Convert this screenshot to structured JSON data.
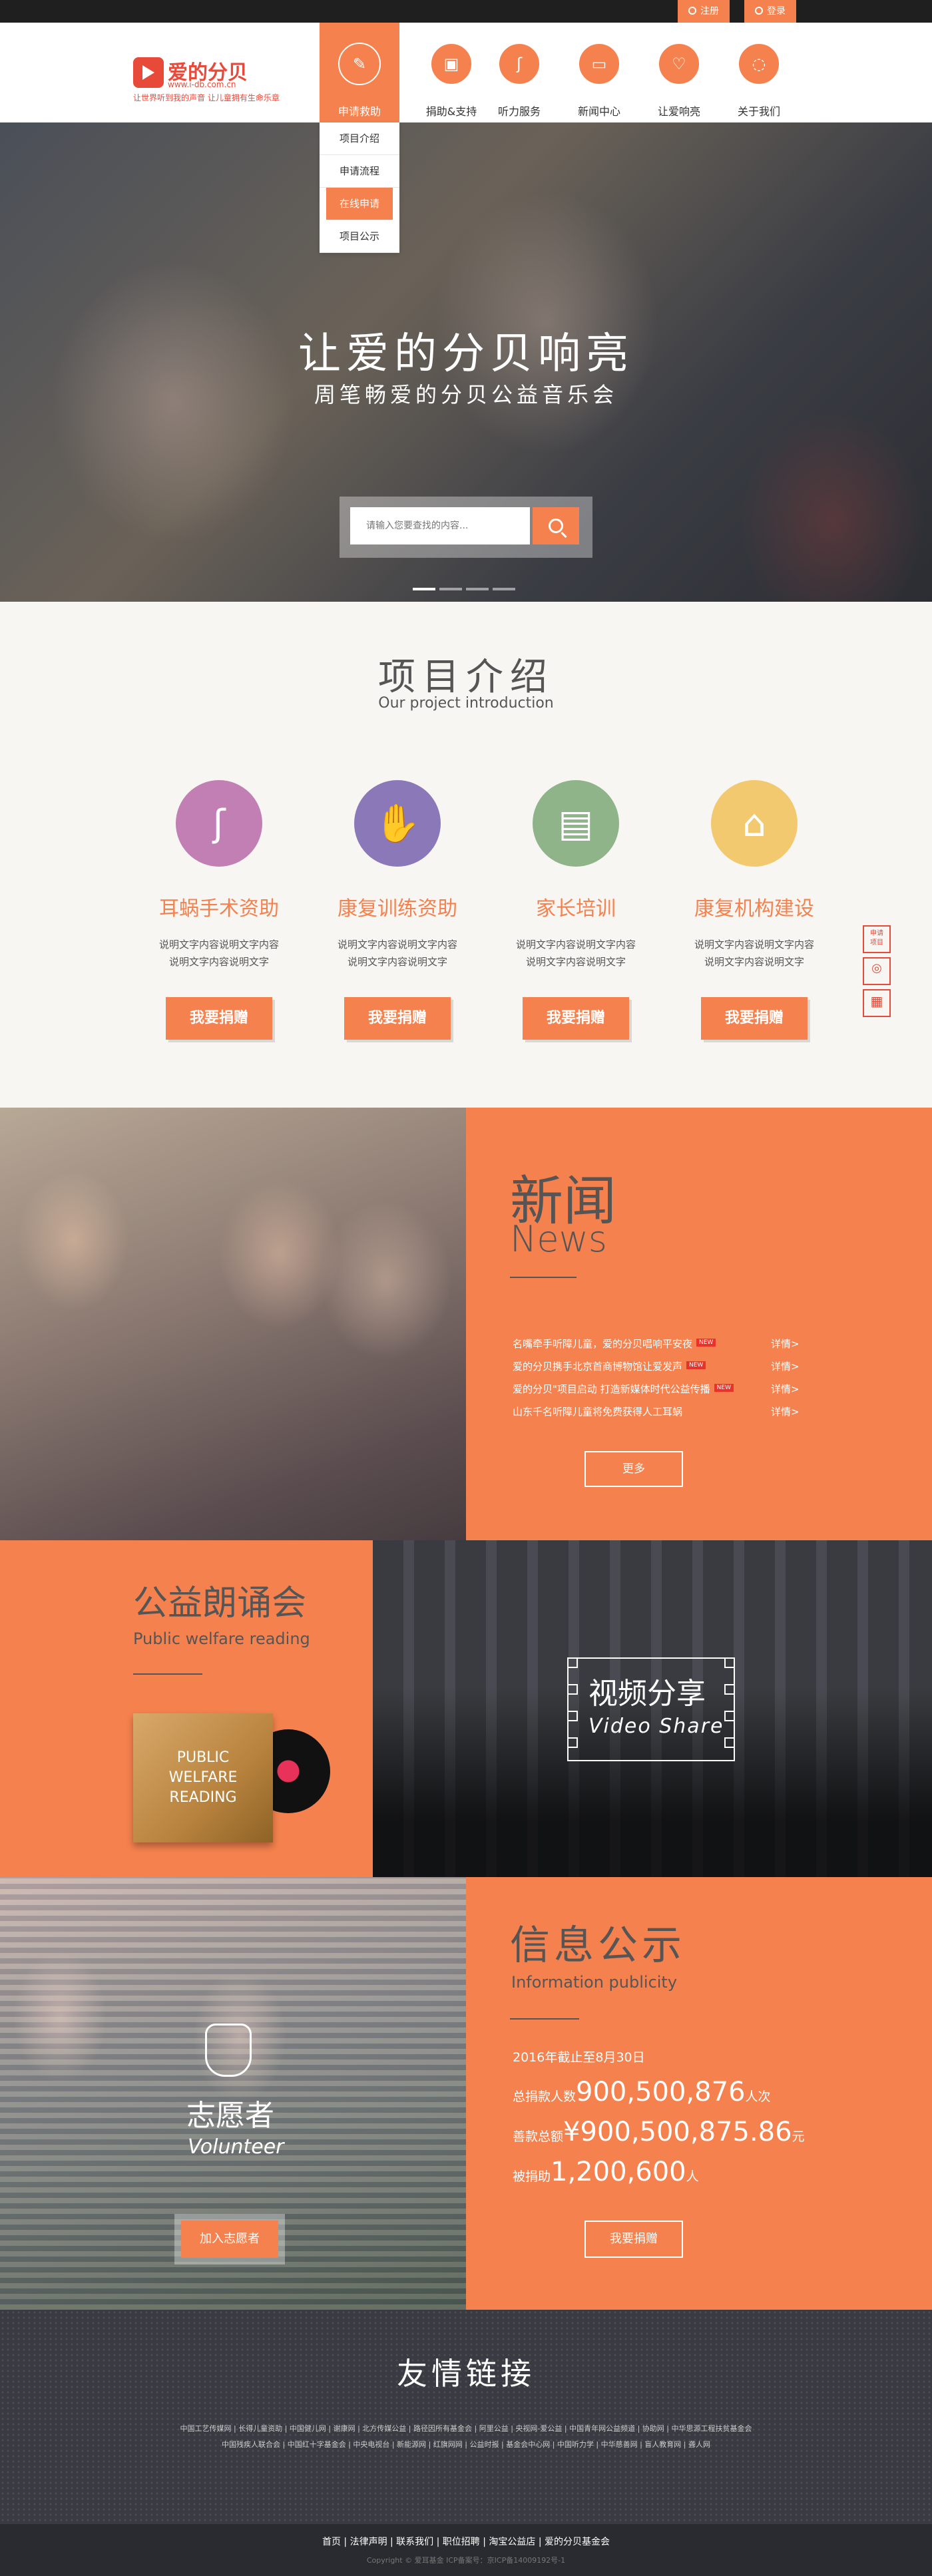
{
  "topbar": {
    "register": "注册",
    "login": "登录"
  },
  "logo": {
    "name": "爱的分贝",
    "url": "www.i-db.com.cn",
    "slogan": "让世界听到我的声音 让儿童拥有生命乐章"
  },
  "nav": [
    {
      "label": "申请救助",
      "icon": "pencil-icon"
    },
    {
      "label": "捐助&支持",
      "icon": "gift-icon"
    },
    {
      "label": "听力服务",
      "icon": "ear-icon"
    },
    {
      "label": "新闻中心",
      "icon": "tv-icon"
    },
    {
      "label": "让爱响亮",
      "icon": "heart-icon"
    },
    {
      "label": "关于我们",
      "icon": "chat-icon"
    }
  ],
  "dropdown": [
    "项目介绍",
    "申请流程",
    "在线申请",
    "项目公示"
  ],
  "hero": {
    "title": "让爱的分贝响亮",
    "subtitle": "周笔畅爱的分贝公益音乐会",
    "search_placeholder": "请输入您要查找的内容..."
  },
  "projects": {
    "title": "项目介绍",
    "title_en": "Our project introduction",
    "items": [
      {
        "name": "耳蜗手术资助",
        "desc1": "说明文字内容说明文字内容",
        "desc2": "说明文字内容说明文字",
        "button": "我要捐赠",
        "color": "#c27fb3"
      },
      {
        "name": "康复训练资助",
        "desc1": "说明文字内容说明文字内容",
        "desc2": "说明文字内容说明文字",
        "button": "我要捐赠",
        "color": "#8b78b8"
      },
      {
        "name": "家长培训",
        "desc1": "说明文字内容说明文字内容",
        "desc2": "说明文字内容说明文字",
        "button": "我要捐赠",
        "color": "#8fb48a"
      },
      {
        "name": "康复机构建设",
        "desc1": "说明文字内容说明文字内容",
        "desc2": "说明文字内容说明文字",
        "button": "我要捐赠",
        "color": "#f2c96e"
      }
    ]
  },
  "side_tools": [
    "申请\n项目",
    "微博",
    "二维码"
  ],
  "news": {
    "title": "新闻",
    "title_en": "News",
    "items": [
      {
        "text": "名嘴牵手听障儿童，爱的分贝唱响平安夜",
        "new": "NEW",
        "more": "详情>"
      },
      {
        "text": "爱的分贝携手北京首商博物馆让爱发声",
        "new": "NEW",
        "more": "详情>"
      },
      {
        "text": "爱的分贝\"项目启动 打造新媒体时代公益传播",
        "new": "NEW",
        "more": "详情>"
      },
      {
        "text": "山东千名听障儿童将免费获得人工耳蜗",
        "new": "",
        "more": "详情>"
      }
    ],
    "more_button": "更多"
  },
  "reading": {
    "title": "公益朗诵会",
    "title_en": "Public welfare reading",
    "album": "PUBLIC\nWELFARE\nREADING"
  },
  "video": {
    "title": "视频分享",
    "title_en": "Video Share"
  },
  "volunteer": {
    "title": "志愿者",
    "title_en": "Volunteer",
    "button": "加入志愿者"
  },
  "info": {
    "title": "信息公示",
    "title_en": "Information publicity",
    "date": "2016年截止至8月30日",
    "donors_label": "总捐款人数",
    "donors_value": "900,500,876",
    "donors_unit": "人次",
    "amount_label": "善款总额",
    "amount_value": "¥900,500,875.86",
    "amount_unit": "元",
    "aided_label": "被捐助",
    "aided_value": "1,200,600",
    "aided_unit": "人",
    "button": "我要捐赠"
  },
  "links": {
    "title": "友情链接",
    "row1": "中国工艺传媒网 | 长得儿童资助 | 中国健儿网 | 谢康网 | 北方传媒公益 | 路径因所有基金会 | 阿里公益 | 央视网-爱公益 | 中国青年网公益频道 | 协助网 | 中华思源工程扶贫基金会",
    "row2": "中国残疾人联合会 | 中国红十字基金会 | 中央电视台 | 新能源网 | 红旗网网 | 公益时报 | 基金会中心网 | 中国听力学 | 中华慈善网 | 盲人教育网 | 聋人网"
  },
  "footer": {
    "nav": "首页 | 法律声明 | 联系我们 | 职位招聘 | 淘宝公益店 | 爱的分贝基金会",
    "copy": "Copyright © 爱耳基金 ICP备案号：京ICP备14009192号-1"
  }
}
